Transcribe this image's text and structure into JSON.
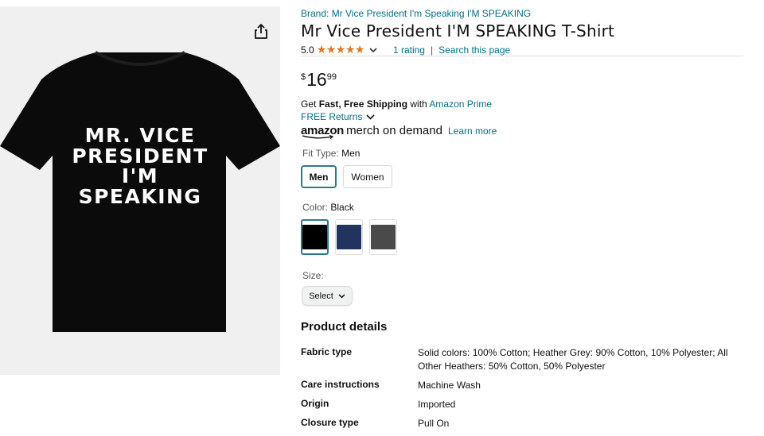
{
  "product_image": {
    "shirt_lines": [
      "MR. VICE",
      "PRESIDENT",
      "I'M",
      "SPEAKING"
    ],
    "share_icon": "share-icon"
  },
  "product": {
    "brand_link": "Brand: Mr Vice President I'm Speaking I'M SPEAKING",
    "title": "Mr Vice President I'M SPEAKING T-Shirt",
    "rating_value": "5.0",
    "stars": "★★★★★",
    "rating_count": "1 rating",
    "rating_separator": "|",
    "search_page": "Search this page"
  },
  "price": {
    "symbol": "$",
    "whole": "16",
    "fraction": "99"
  },
  "shipping": {
    "get": "Get ",
    "fast_free": "Fast, Free Shipping",
    "with": " with ",
    "prime_link": "Amazon Prime",
    "returns": "FREE Returns",
    "amazon": "amazon",
    "merch": "merch on demand",
    "learn_more": "Learn more"
  },
  "fit_type": {
    "label": "Fit Type: ",
    "selected": "Men",
    "options": [
      "Men",
      "Women"
    ]
  },
  "color": {
    "label": "Color: ",
    "selected": "Black",
    "swatches": [
      "#000000",
      "#233360",
      "#4a4a4a"
    ]
  },
  "size": {
    "label": "Size:",
    "select_label": "Select"
  },
  "product_details": {
    "heading": "Product details",
    "rows": [
      {
        "key": "Fabric type",
        "value": "Solid colors: 100% Cotton; Heather Grey: 90% Cotton, 10% Polyester; All Other Heathers: 50% Cotton, 50% Polyester"
      },
      {
        "key": "Care instructions",
        "value": "Machine Wash"
      },
      {
        "key": "Origin",
        "value": "Imported"
      },
      {
        "key": "Closure type",
        "value": "Pull On"
      }
    ]
  },
  "colors": {
    "link": "#007185",
    "star": "#de7921",
    "selected_border": "#2b7a8a"
  }
}
